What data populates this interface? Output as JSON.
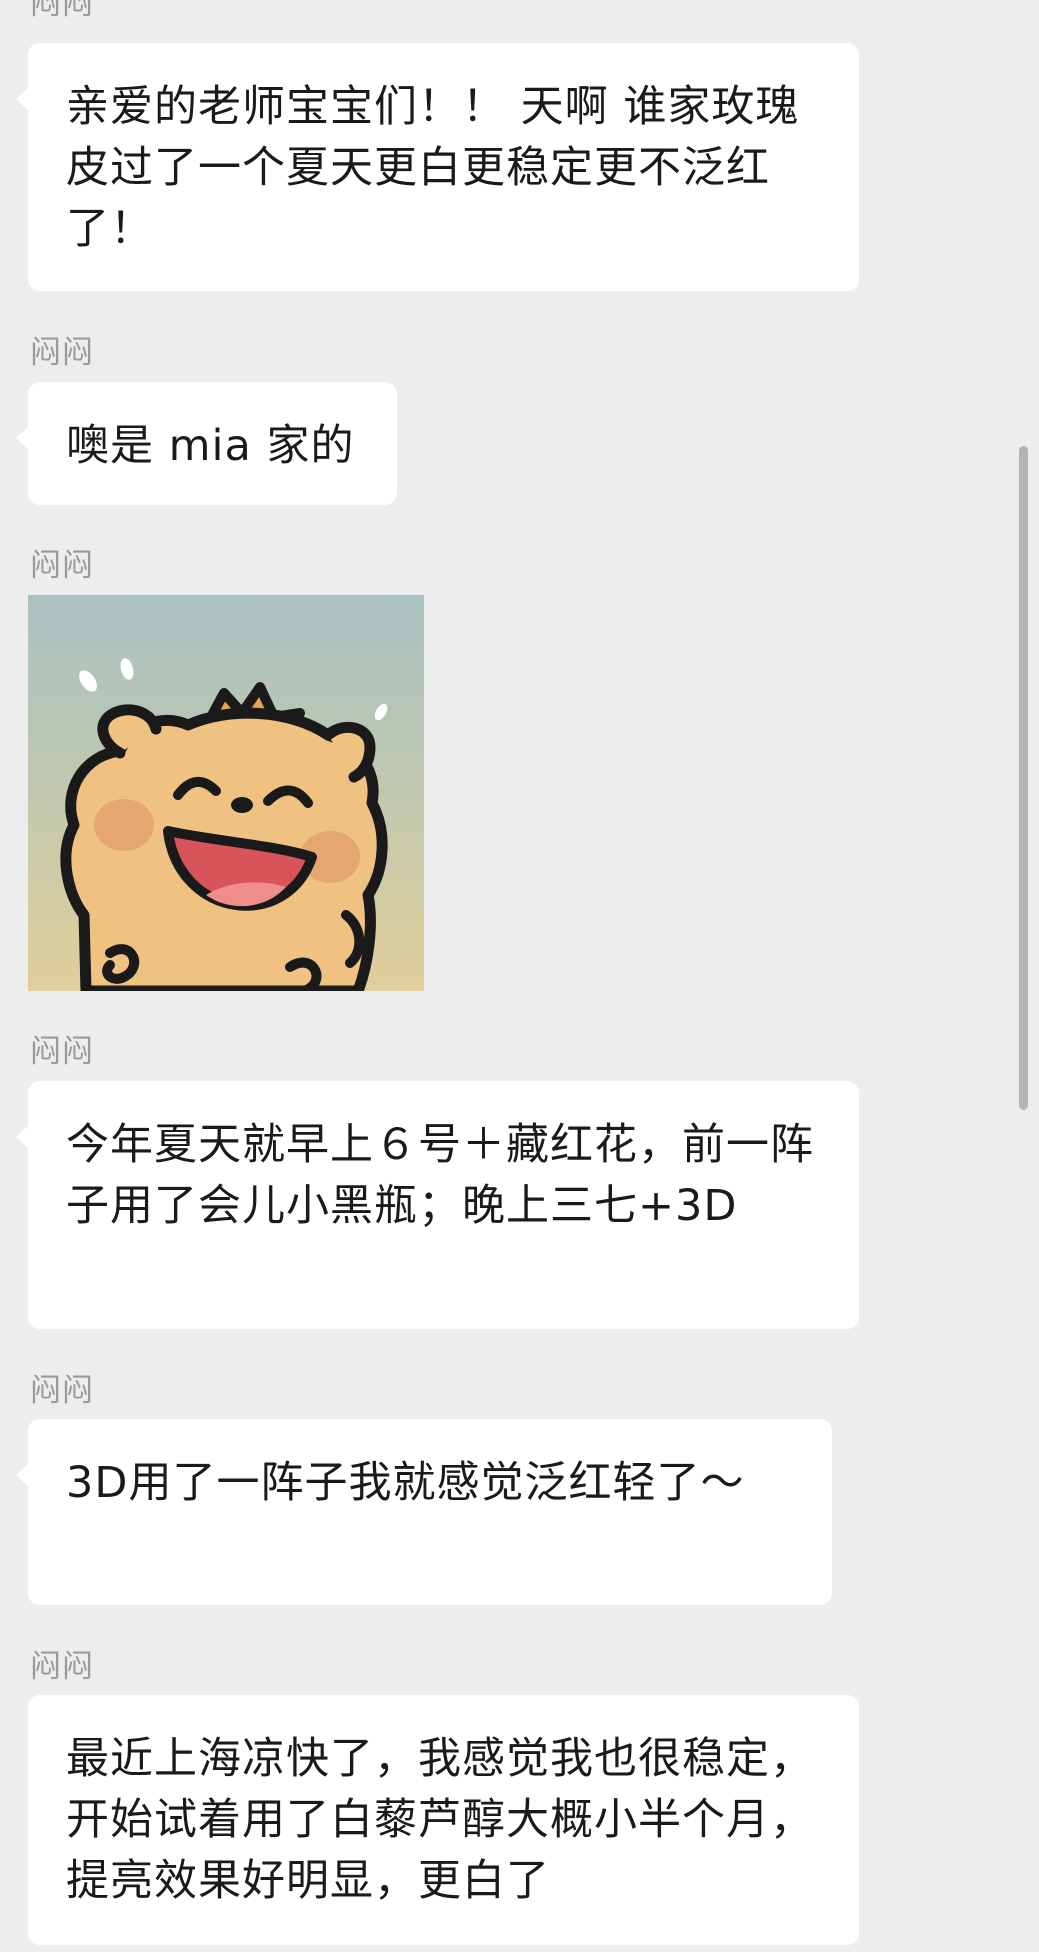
{
  "messages": [
    {
      "sender": "闷闷",
      "type": "text",
      "text": "亲爱的老师宝宝们！！ 天啊 谁家玫瑰皮过了一个夏天更白更稳定更不泛红了！"
    },
    {
      "sender": "闷闷",
      "type": "text",
      "text": "噢是 mia 家的"
    },
    {
      "sender": "闷闷",
      "type": "sticker",
      "sticker": "laughing-bear-sticker"
    },
    {
      "sender": "闷闷",
      "type": "text",
      "text": "今年夏天就早上６号＋藏红花，前一阵子用了会儿小黑瓶；晚上三七+3D"
    },
    {
      "sender": "闷闷",
      "type": "text",
      "text": "3D用了一阵子我就感觉泛红轻了～"
    },
    {
      "sender": "闷闷",
      "type": "text",
      "text": "最近上海凉快了，我感觉我也很稳定，开始试着用了白藜芦醇大概小半个月，提亮效果好明显，更白了"
    }
  ],
  "colors": {
    "background": "#ededed",
    "bubble": "#ffffff",
    "sender_text": "#9a9a9a",
    "message_text": "#1a1a1a",
    "scrollbar": "#b5b5b5"
  }
}
